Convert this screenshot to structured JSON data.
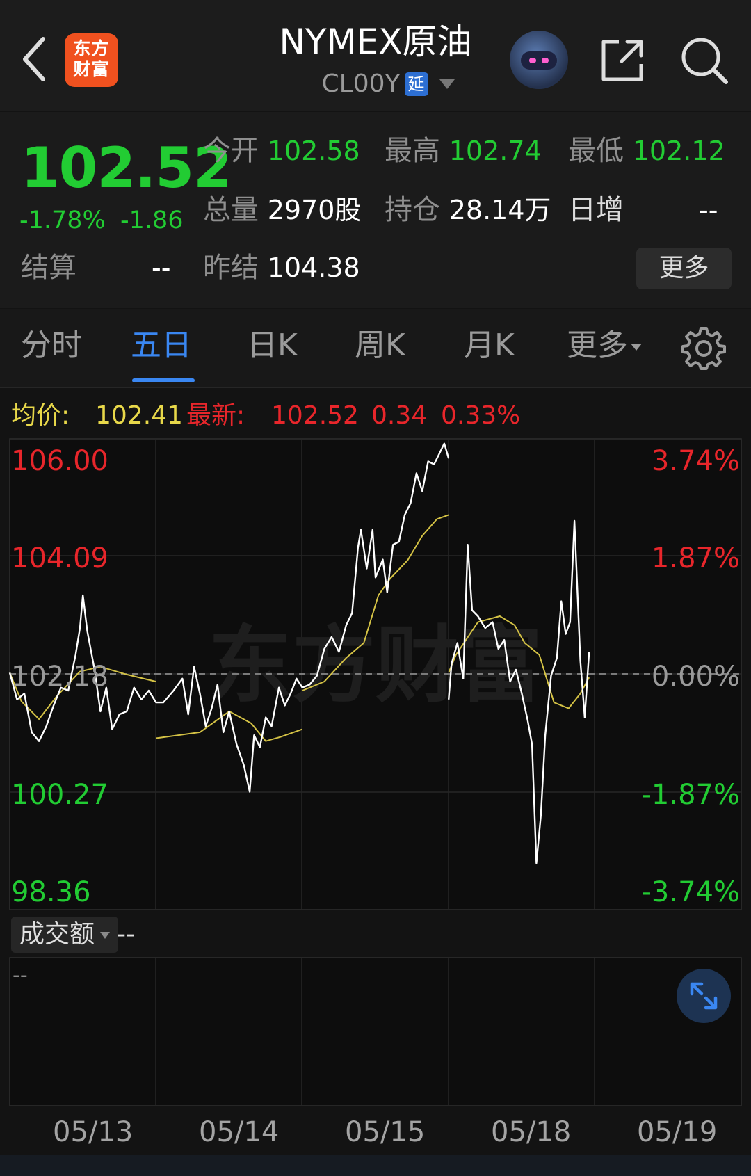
{
  "header": {
    "logo_line1": "东方",
    "logo_line2": "财富",
    "title": "NYMEX原油",
    "code": "CL00Y",
    "delay_badge": "延"
  },
  "quote": {
    "price": "102.52",
    "change_pct": "-1.78%",
    "change": "-1.86",
    "open_label": "今开",
    "open": "102.58",
    "high_label": "最高",
    "high": "102.74",
    "low_label": "最低",
    "low": "102.12",
    "volume_label": "总量",
    "volume": "2970股",
    "oi_label": "持仓",
    "oi": "28.14万",
    "daily_inc_label": "日增",
    "daily_inc": "--",
    "settle_label": "结算",
    "settle": "--",
    "prev_settle_label": "昨结",
    "prev_settle": "104.38",
    "more_label": "更多"
  },
  "tabs": [
    "分时",
    "五日",
    "日K",
    "周K",
    "月K",
    "更多"
  ],
  "active_tab": "五日",
  "info_bar": {
    "avg_label": "均价:",
    "avg": "102.41",
    "last_label": "最新:",
    "last": "102.52",
    "chg": "0.34",
    "chg_pct": "0.33%"
  },
  "chart": {
    "watermark": "东方财富",
    "y_left": [
      "106.00",
      "104.09",
      "102.18",
      "100.27",
      "98.36"
    ],
    "y_right": [
      "3.74%",
      "1.87%",
      "0.00%",
      "-1.87%",
      "-3.74%"
    ],
    "colors": {
      "up": "#e8262b",
      "down": "#22cc33",
      "flat": "#bbbbbb",
      "price_line": "#ffffff",
      "avg_line": "#d4c245"
    }
  },
  "volume": {
    "select_label": "成交额",
    "value": "--",
    "placeholder": "--"
  },
  "dates": [
    "05/13",
    "05/14",
    "05/15",
    "05/18",
    "05/19"
  ],
  "chart_data": {
    "type": "line",
    "x": [
      "05/13",
      "05/14",
      "05/15",
      "05/18",
      "05/19"
    ],
    "ylim": [
      98.36,
      106.0
    ],
    "reference": 102.18,
    "series": [
      {
        "name": "均价",
        "color": "#d4c245",
        "points": [
          [
            0.0,
            102.2
          ],
          [
            0.08,
            101.72
          ],
          [
            0.2,
            101.42
          ],
          [
            0.32,
            101.8
          ],
          [
            0.48,
            102.22
          ],
          [
            0.62,
            102.3
          ],
          [
            0.8,
            102.17
          ],
          [
            1.0,
            102.05
          ],
          [
            1.0,
            101.1
          ],
          [
            1.3,
            101.2
          ],
          [
            1.5,
            101.55
          ],
          [
            1.65,
            101.35
          ],
          [
            1.75,
            101.05
          ],
          [
            1.85,
            101.12
          ],
          [
            2.0,
            101.25
          ],
          [
            2.0,
            101.9
          ],
          [
            2.15,
            102.05
          ],
          [
            2.3,
            102.45
          ],
          [
            2.42,
            102.7
          ],
          [
            2.52,
            103.5
          ],
          [
            2.6,
            103.78
          ],
          [
            2.72,
            104.09
          ],
          [
            2.82,
            104.5
          ],
          [
            2.92,
            104.78
          ],
          [
            3.0,
            104.85
          ],
          [
            3.0,
            102.2
          ],
          [
            3.05,
            102.5
          ],
          [
            3.2,
            103.05
          ],
          [
            3.35,
            103.15
          ],
          [
            3.45,
            103.0
          ],
          [
            3.52,
            102.7
          ],
          [
            3.62,
            102.5
          ],
          [
            3.72,
            101.7
          ],
          [
            3.82,
            101.6
          ],
          [
            3.9,
            101.85
          ],
          [
            3.96,
            102.12
          ]
        ]
      },
      {
        "name": "最新",
        "color": "#ffffff",
        "points": [
          [
            0.0,
            102.2
          ],
          [
            0.05,
            101.75
          ],
          [
            0.1,
            101.85
          ],
          [
            0.15,
            101.2
          ],
          [
            0.2,
            101.05
          ],
          [
            0.25,
            101.3
          ],
          [
            0.3,
            101.65
          ],
          [
            0.35,
            101.95
          ],
          [
            0.4,
            101.9
          ],
          [
            0.45,
            102.5
          ],
          [
            0.48,
            102.95
          ],
          [
            0.5,
            103.5
          ],
          [
            0.53,
            102.9
          ],
          [
            0.58,
            102.25
          ],
          [
            0.62,
            101.55
          ],
          [
            0.66,
            101.95
          ],
          [
            0.7,
            101.25
          ],
          [
            0.75,
            101.5
          ],
          [
            0.8,
            101.55
          ],
          [
            0.85,
            101.95
          ],
          [
            0.9,
            101.75
          ],
          [
            0.95,
            101.9
          ],
          [
            1.0,
            101.7
          ],
          [
            1.05,
            101.7
          ],
          [
            1.12,
            101.9
          ],
          [
            1.18,
            102.1
          ],
          [
            1.22,
            101.5
          ],
          [
            1.26,
            102.3
          ],
          [
            1.3,
            101.85
          ],
          [
            1.34,
            101.3
          ],
          [
            1.38,
            101.6
          ],
          [
            1.42,
            102.0
          ],
          [
            1.46,
            101.2
          ],
          [
            1.5,
            101.55
          ],
          [
            1.55,
            101.0
          ],
          [
            1.6,
            100.65
          ],
          [
            1.64,
            100.2
          ],
          [
            1.67,
            101.15
          ],
          [
            1.71,
            100.95
          ],
          [
            1.75,
            101.45
          ],
          [
            1.79,
            101.3
          ],
          [
            1.84,
            101.95
          ],
          [
            1.88,
            101.65
          ],
          [
            1.92,
            101.85
          ],
          [
            1.96,
            102.1
          ],
          [
            2.0,
            101.95
          ],
          [
            2.05,
            102.0
          ],
          [
            2.1,
            102.15
          ],
          [
            2.15,
            102.6
          ],
          [
            2.2,
            102.8
          ],
          [
            2.25,
            102.55
          ],
          [
            2.3,
            103.0
          ],
          [
            2.34,
            103.2
          ],
          [
            2.38,
            104.3
          ],
          [
            2.4,
            104.6
          ],
          [
            2.44,
            103.95
          ],
          [
            2.48,
            104.6
          ],
          [
            2.5,
            103.8
          ],
          [
            2.55,
            104.1
          ],
          [
            2.58,
            103.55
          ],
          [
            2.62,
            104.35
          ],
          [
            2.66,
            104.4
          ],
          [
            2.7,
            104.85
          ],
          [
            2.74,
            105.05
          ],
          [
            2.78,
            105.55
          ],
          [
            2.82,
            105.25
          ],
          [
            2.86,
            105.75
          ],
          [
            2.9,
            105.7
          ],
          [
            2.94,
            105.9
          ],
          [
            2.97,
            106.05
          ],
          [
            3.0,
            105.8
          ],
          [
            3.0,
            101.75
          ],
          [
            3.02,
            102.35
          ],
          [
            3.06,
            102.7
          ],
          [
            3.1,
            102.1
          ],
          [
            3.13,
            104.35
          ],
          [
            3.16,
            103.25
          ],
          [
            3.2,
            103.15
          ],
          [
            3.25,
            102.95
          ],
          [
            3.3,
            103.05
          ],
          [
            3.34,
            102.6
          ],
          [
            3.38,
            102.75
          ],
          [
            3.42,
            102.05
          ],
          [
            3.46,
            102.25
          ],
          [
            3.5,
            101.85
          ],
          [
            3.54,
            101.4
          ],
          [
            3.57,
            101.0
          ],
          [
            3.6,
            99.0
          ],
          [
            3.63,
            99.8
          ],
          [
            3.66,
            101.15
          ],
          [
            3.7,
            102.15
          ],
          [
            3.74,
            102.45
          ],
          [
            3.77,
            103.4
          ],
          [
            3.8,
            102.85
          ],
          [
            3.83,
            103.05
          ],
          [
            3.86,
            104.75
          ],
          [
            3.9,
            102.4
          ],
          [
            3.93,
            101.45
          ],
          [
            3.96,
            102.55
          ]
        ]
      }
    ]
  }
}
